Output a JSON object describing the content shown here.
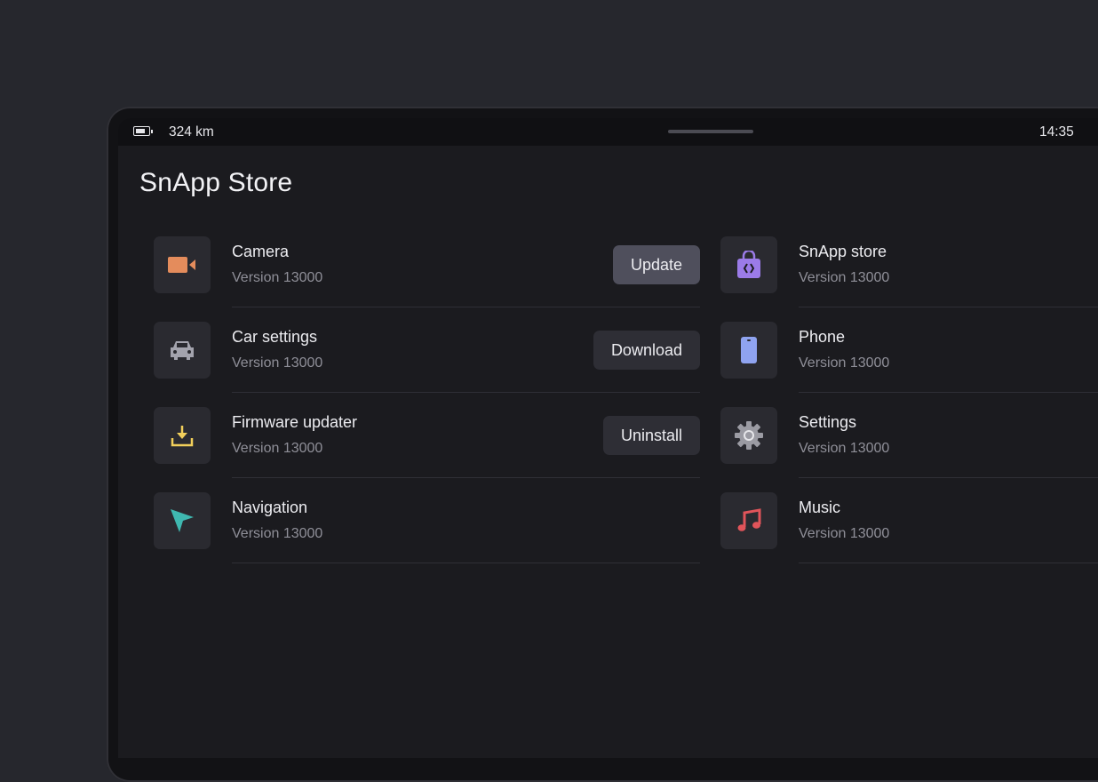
{
  "status": {
    "range": "324 km",
    "time": "14:35"
  },
  "title": "SnApp Store",
  "apps_left": [
    {
      "name": "Camera",
      "version": "Version 13000",
      "action": "Update",
      "icon": "camera-icon",
      "color": "#e48c5c"
    },
    {
      "name": "Car settings",
      "version": "Version 13000",
      "action": "Download",
      "icon": "car-icon",
      "color": "#a3a3ad"
    },
    {
      "name": "Firmware updater",
      "version": "Version 13000",
      "action": "Uninstall",
      "icon": "download-icon",
      "color": "#f2cf5b"
    },
    {
      "name": "Navigation",
      "version": "Version 13000",
      "action": "",
      "icon": "navigation-arrow-icon",
      "color": "#3fb8b0"
    }
  ],
  "apps_right": [
    {
      "name": "SnApp store",
      "version": "Version 13000",
      "icon": "shopping-bag-icon",
      "color": "#9b7be8"
    },
    {
      "name": "Phone",
      "version": "Version 13000",
      "icon": "phone-icon",
      "color": "#8fa3f0"
    },
    {
      "name": "Settings",
      "version": "Version 13000",
      "icon": "gear-icon",
      "color": "#9b9ba3"
    },
    {
      "name": "Music",
      "version": "Version 13000",
      "icon": "music-note-icon",
      "color": "#e0545a"
    }
  ]
}
